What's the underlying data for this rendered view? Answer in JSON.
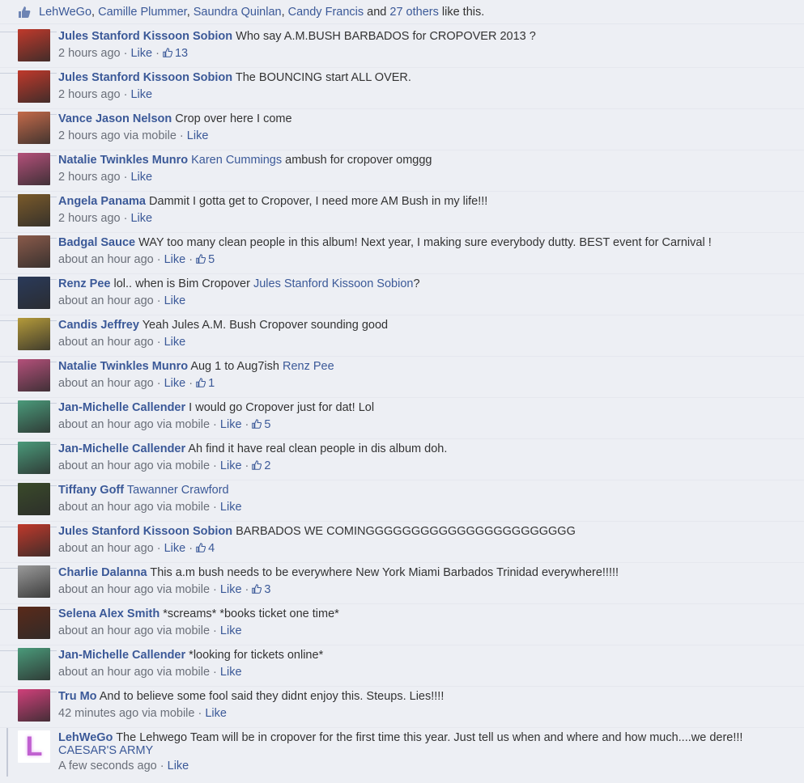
{
  "likes_bar": {
    "names": [
      "LehWeGo",
      "Camille Plummer",
      "Saundra Quinlan",
      "Candy Francis"
    ],
    "and": "and",
    "others": "27 others",
    "suffix": "like this."
  },
  "comments": [
    {
      "name": "Jules Stanford Kissoon Sobion",
      "text": "Who say A.M.BUSH BARBADOS for CROPOVER 2013 ?",
      "time": "2 hours ago",
      "via": "",
      "like": "Like",
      "likes": "13",
      "avatar_color": "#c0392b"
    },
    {
      "name": "Jules Stanford Kissoon Sobion",
      "text": "The BOUNCING start ALL OVER.",
      "time": "2 hours ago",
      "via": "",
      "like": "Like",
      "likes": "",
      "avatar_color": "#c0392b"
    },
    {
      "name": "Vance Jason Nelson",
      "text": "Crop over here I come",
      "time": "2 hours ago",
      "via": "via mobile",
      "like": "Like",
      "likes": "",
      "avatar_color": "#c46a4a"
    },
    {
      "name": "Natalie Twinkles Munro",
      "mention": "Karen Cummings",
      "text": "ambush for cropover omggg",
      "time": "2 hours ago",
      "via": "",
      "like": "Like",
      "likes": "",
      "avatar_color": "#b4507a"
    },
    {
      "name": "Angela Panama",
      "text": "Dammit I gotta get to Cropover, I need more AM Bush in my life!!!",
      "time": "2 hours ago",
      "via": "",
      "like": "Like",
      "likes": "",
      "avatar_color": "#7a5a2a"
    },
    {
      "name": "Badgal Sauce",
      "text": "WAY too many clean people in this album! Next year, I making sure everybody dutty. BEST event for Carnival !",
      "time": "about an hour ago",
      "via": "",
      "like": "Like",
      "likes": "5",
      "avatar_color": "#8a5a4a"
    },
    {
      "name": "Renz Pee",
      "text": "lol.. when is Bim Cropover",
      "mention_after": "Jules Stanford Kissoon Sobion",
      "tail": "?",
      "time": "about an hour ago",
      "via": "",
      "like": "Like",
      "likes": "",
      "avatar_color": "#2a3a5a"
    },
    {
      "name": "Candis Jeffrey",
      "text": "Yeah Jules A.M. Bush Cropover sounding good",
      "time": "about an hour ago",
      "via": "",
      "like": "Like",
      "likes": "",
      "avatar_color": "#b49a3a"
    },
    {
      "name": "Natalie Twinkles Munro",
      "text": "Aug 1 to Aug7ish",
      "mention_after": "Renz Pee",
      "tail": "",
      "time": "about an hour ago",
      "via": "",
      "like": "Like",
      "likes": "1",
      "avatar_color": "#b4507a"
    },
    {
      "name": "Jan-Michelle Callender",
      "text": "I would go Cropover just for dat! Lol",
      "time": "about an hour ago",
      "via": "via mobile",
      "like": "Like",
      "likes": "5",
      "avatar_color": "#4a9a7a"
    },
    {
      "name": "Jan-Michelle Callender",
      "text": "Ah find it have real clean people in dis album doh.",
      "time": "about an hour ago",
      "via": "via mobile",
      "like": "Like",
      "likes": "2",
      "avatar_color": "#4a9a7a"
    },
    {
      "name": "Tiffany Goff",
      "mention": "Tawanner Crawford",
      "text": "",
      "time": "about an hour ago",
      "via": "via mobile",
      "like": "Like",
      "likes": "",
      "avatar_color": "#3a4a2a"
    },
    {
      "name": "Jules Stanford Kissoon Sobion",
      "text": "BARBADOS WE COMINGGGGGGGGGGGGGGGGGGGGGGG",
      "time": "about an hour ago",
      "via": "",
      "like": "Like",
      "likes": "4",
      "avatar_color": "#c0392b"
    },
    {
      "name": "Charlie Dalanna",
      "text": "This a.m bush needs to be everywhere New York Miami Barbados Trinidad everywhere!!!!!",
      "time": "about an hour ago",
      "via": "via mobile",
      "like": "Like",
      "likes": "3",
      "avatar_color": "#9a9a9a"
    },
    {
      "name": "Selena Alex Smith",
      "text": "*screams* *books ticket one time*",
      "time": "about an hour ago",
      "via": "via mobile",
      "like": "Like",
      "likes": "",
      "avatar_color": "#5a2a1a"
    },
    {
      "name": "Jan-Michelle Callender",
      "text": "*looking for tickets online*",
      "time": "about an hour ago",
      "via": "via mobile",
      "like": "Like",
      "likes": "",
      "avatar_color": "#4a9a7a"
    },
    {
      "name": "Tru Mo",
      "text": "And to believe some fool said they didnt enjoy this. Steups. Lies!!!!",
      "time": "42 minutes ago",
      "via": "via mobile",
      "like": "Like",
      "likes": "",
      "avatar_color": "#d0407a"
    },
    {
      "name": "LehWeGo",
      "text": "The Lehwego Team will be in cropover for the first time this year. Just tell us when and where and how much....we dere!!!",
      "line2": "CAESAR'S ARMY",
      "time": "A few seconds ago",
      "via": "",
      "like": "Like",
      "likes": "",
      "avatar_letter": "L",
      "avatar_color": "#ffffff"
    }
  ]
}
